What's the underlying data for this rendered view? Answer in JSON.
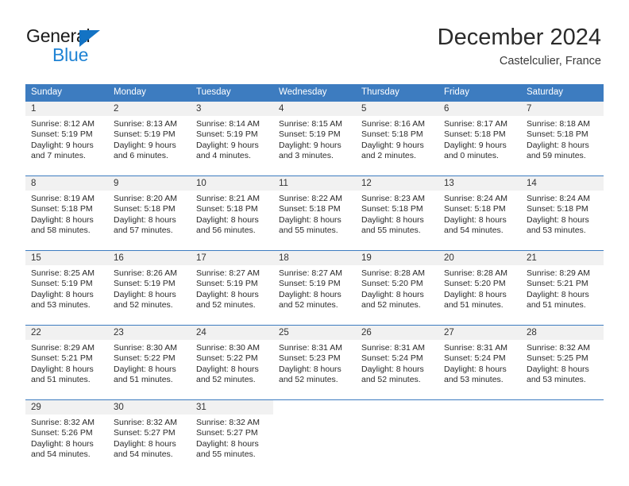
{
  "brand": {
    "name_top": "General",
    "name_bottom": "Blue",
    "triangle_color": "#1373c4",
    "blue_text_color": "#1f83d4"
  },
  "header": {
    "title": "December 2024",
    "subtitle": "Castelculier, France"
  },
  "theme": {
    "header_blue": "#3d7cc0",
    "daynum_band": "#f1f1f1",
    "cell_background": "#ffffff",
    "text_color": "#2a2a2a"
  },
  "weekday_headers": [
    "Sunday",
    "Monday",
    "Tuesday",
    "Wednesday",
    "Thursday",
    "Friday",
    "Saturday"
  ],
  "weeks": [
    [
      {
        "day": "1",
        "sunrise": "Sunrise: 8:12 AM",
        "sunset": "Sunset: 5:19 PM",
        "daylight1": "Daylight: 9 hours",
        "daylight2": "and 7 minutes."
      },
      {
        "day": "2",
        "sunrise": "Sunrise: 8:13 AM",
        "sunset": "Sunset: 5:19 PM",
        "daylight1": "Daylight: 9 hours",
        "daylight2": "and 6 minutes."
      },
      {
        "day": "3",
        "sunrise": "Sunrise: 8:14 AM",
        "sunset": "Sunset: 5:19 PM",
        "daylight1": "Daylight: 9 hours",
        "daylight2": "and 4 minutes."
      },
      {
        "day": "4",
        "sunrise": "Sunrise: 8:15 AM",
        "sunset": "Sunset: 5:19 PM",
        "daylight1": "Daylight: 9 hours",
        "daylight2": "and 3 minutes."
      },
      {
        "day": "5",
        "sunrise": "Sunrise: 8:16 AM",
        "sunset": "Sunset: 5:18 PM",
        "daylight1": "Daylight: 9 hours",
        "daylight2": "and 2 minutes."
      },
      {
        "day": "6",
        "sunrise": "Sunrise: 8:17 AM",
        "sunset": "Sunset: 5:18 PM",
        "daylight1": "Daylight: 9 hours",
        "daylight2": "and 0 minutes."
      },
      {
        "day": "7",
        "sunrise": "Sunrise: 8:18 AM",
        "sunset": "Sunset: 5:18 PM",
        "daylight1": "Daylight: 8 hours",
        "daylight2": "and 59 minutes."
      }
    ],
    [
      {
        "day": "8",
        "sunrise": "Sunrise: 8:19 AM",
        "sunset": "Sunset: 5:18 PM",
        "daylight1": "Daylight: 8 hours",
        "daylight2": "and 58 minutes."
      },
      {
        "day": "9",
        "sunrise": "Sunrise: 8:20 AM",
        "sunset": "Sunset: 5:18 PM",
        "daylight1": "Daylight: 8 hours",
        "daylight2": "and 57 minutes."
      },
      {
        "day": "10",
        "sunrise": "Sunrise: 8:21 AM",
        "sunset": "Sunset: 5:18 PM",
        "daylight1": "Daylight: 8 hours",
        "daylight2": "and 56 minutes."
      },
      {
        "day": "11",
        "sunrise": "Sunrise: 8:22 AM",
        "sunset": "Sunset: 5:18 PM",
        "daylight1": "Daylight: 8 hours",
        "daylight2": "and 55 minutes."
      },
      {
        "day": "12",
        "sunrise": "Sunrise: 8:23 AM",
        "sunset": "Sunset: 5:18 PM",
        "daylight1": "Daylight: 8 hours",
        "daylight2": "and 55 minutes."
      },
      {
        "day": "13",
        "sunrise": "Sunrise: 8:24 AM",
        "sunset": "Sunset: 5:18 PM",
        "daylight1": "Daylight: 8 hours",
        "daylight2": "and 54 minutes."
      },
      {
        "day": "14",
        "sunrise": "Sunrise: 8:24 AM",
        "sunset": "Sunset: 5:18 PM",
        "daylight1": "Daylight: 8 hours",
        "daylight2": "and 53 minutes."
      }
    ],
    [
      {
        "day": "15",
        "sunrise": "Sunrise: 8:25 AM",
        "sunset": "Sunset: 5:19 PM",
        "daylight1": "Daylight: 8 hours",
        "daylight2": "and 53 minutes."
      },
      {
        "day": "16",
        "sunrise": "Sunrise: 8:26 AM",
        "sunset": "Sunset: 5:19 PM",
        "daylight1": "Daylight: 8 hours",
        "daylight2": "and 52 minutes."
      },
      {
        "day": "17",
        "sunrise": "Sunrise: 8:27 AM",
        "sunset": "Sunset: 5:19 PM",
        "daylight1": "Daylight: 8 hours",
        "daylight2": "and 52 minutes."
      },
      {
        "day": "18",
        "sunrise": "Sunrise: 8:27 AM",
        "sunset": "Sunset: 5:19 PM",
        "daylight1": "Daylight: 8 hours",
        "daylight2": "and 52 minutes."
      },
      {
        "day": "19",
        "sunrise": "Sunrise: 8:28 AM",
        "sunset": "Sunset: 5:20 PM",
        "daylight1": "Daylight: 8 hours",
        "daylight2": "and 52 minutes."
      },
      {
        "day": "20",
        "sunrise": "Sunrise: 8:28 AM",
        "sunset": "Sunset: 5:20 PM",
        "daylight1": "Daylight: 8 hours",
        "daylight2": "and 51 minutes."
      },
      {
        "day": "21",
        "sunrise": "Sunrise: 8:29 AM",
        "sunset": "Sunset: 5:21 PM",
        "daylight1": "Daylight: 8 hours",
        "daylight2": "and 51 minutes."
      }
    ],
    [
      {
        "day": "22",
        "sunrise": "Sunrise: 8:29 AM",
        "sunset": "Sunset: 5:21 PM",
        "daylight1": "Daylight: 8 hours",
        "daylight2": "and 51 minutes."
      },
      {
        "day": "23",
        "sunrise": "Sunrise: 8:30 AM",
        "sunset": "Sunset: 5:22 PM",
        "daylight1": "Daylight: 8 hours",
        "daylight2": "and 51 minutes."
      },
      {
        "day": "24",
        "sunrise": "Sunrise: 8:30 AM",
        "sunset": "Sunset: 5:22 PM",
        "daylight1": "Daylight: 8 hours",
        "daylight2": "and 52 minutes."
      },
      {
        "day": "25",
        "sunrise": "Sunrise: 8:31 AM",
        "sunset": "Sunset: 5:23 PM",
        "daylight1": "Daylight: 8 hours",
        "daylight2": "and 52 minutes."
      },
      {
        "day": "26",
        "sunrise": "Sunrise: 8:31 AM",
        "sunset": "Sunset: 5:24 PM",
        "daylight1": "Daylight: 8 hours",
        "daylight2": "and 52 minutes."
      },
      {
        "day": "27",
        "sunrise": "Sunrise: 8:31 AM",
        "sunset": "Sunset: 5:24 PM",
        "daylight1": "Daylight: 8 hours",
        "daylight2": "and 53 minutes."
      },
      {
        "day": "28",
        "sunrise": "Sunrise: 8:32 AM",
        "sunset": "Sunset: 5:25 PM",
        "daylight1": "Daylight: 8 hours",
        "daylight2": "and 53 minutes."
      }
    ],
    [
      {
        "day": "29",
        "sunrise": "Sunrise: 8:32 AM",
        "sunset": "Sunset: 5:26 PM",
        "daylight1": "Daylight: 8 hours",
        "daylight2": "and 54 minutes."
      },
      {
        "day": "30",
        "sunrise": "Sunrise: 8:32 AM",
        "sunset": "Sunset: 5:27 PM",
        "daylight1": "Daylight: 8 hours",
        "daylight2": "and 54 minutes."
      },
      {
        "day": "31",
        "sunrise": "Sunrise: 8:32 AM",
        "sunset": "Sunset: 5:27 PM",
        "daylight1": "Daylight: 8 hours",
        "daylight2": "and 55 minutes."
      },
      {
        "day": "",
        "sunrise": "",
        "sunset": "",
        "daylight1": "",
        "daylight2": ""
      },
      {
        "day": "",
        "sunrise": "",
        "sunset": "",
        "daylight1": "",
        "daylight2": ""
      },
      {
        "day": "",
        "sunrise": "",
        "sunset": "",
        "daylight1": "",
        "daylight2": ""
      },
      {
        "day": "",
        "sunrise": "",
        "sunset": "",
        "daylight1": "",
        "daylight2": ""
      }
    ]
  ]
}
